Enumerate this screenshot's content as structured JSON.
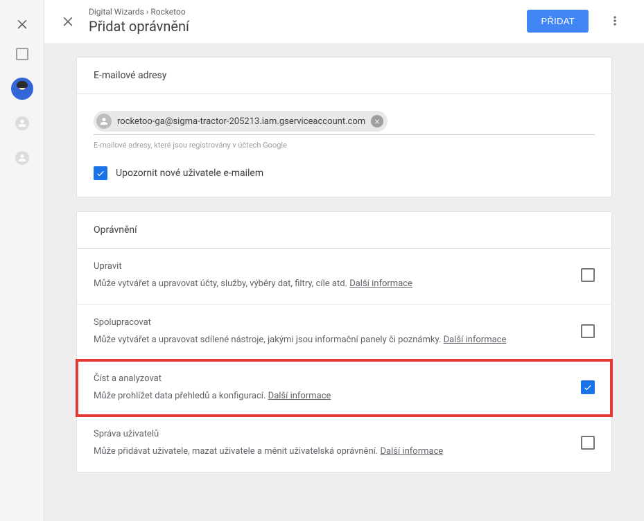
{
  "breadcrumb": "Digital Wizards › Rocketoo",
  "page_title": "Přidat oprávnění",
  "primary_button": "PŘIDAT",
  "email_card": {
    "header": "E-mailové adresy",
    "chip_email": "rocketoo-ga@sigma-tractor-205213.iam.gserviceaccount.com",
    "helper": "E-mailové adresy, které jsou registrovány v účtech Google",
    "notify_label": "Upozornit nové uživatele e-mailem"
  },
  "perm_card": {
    "header": "Oprávnění",
    "more_label": "Další informace",
    "items": [
      {
        "title": "Upravit",
        "desc": "Může vytvářet a upravovat účty, služby, výběry dat, filtry, cíle atd. ",
        "checked": false,
        "highlight": false
      },
      {
        "title": "Spolupracovat",
        "desc": "Může vytvářet a upravovat sdílené nástroje, jakými jsou informační panely či poznámky. ",
        "checked": false,
        "highlight": false
      },
      {
        "title": "Číst a analyzovat",
        "desc": "Může prohlížet data přehledů a konfigurací. ",
        "checked": true,
        "highlight": true
      },
      {
        "title": "Správa uživatelů",
        "desc": "Může přidávat uživatele, mazat uživatele a měnit uživatelská oprávnění. ",
        "checked": false,
        "highlight": false
      }
    ]
  }
}
